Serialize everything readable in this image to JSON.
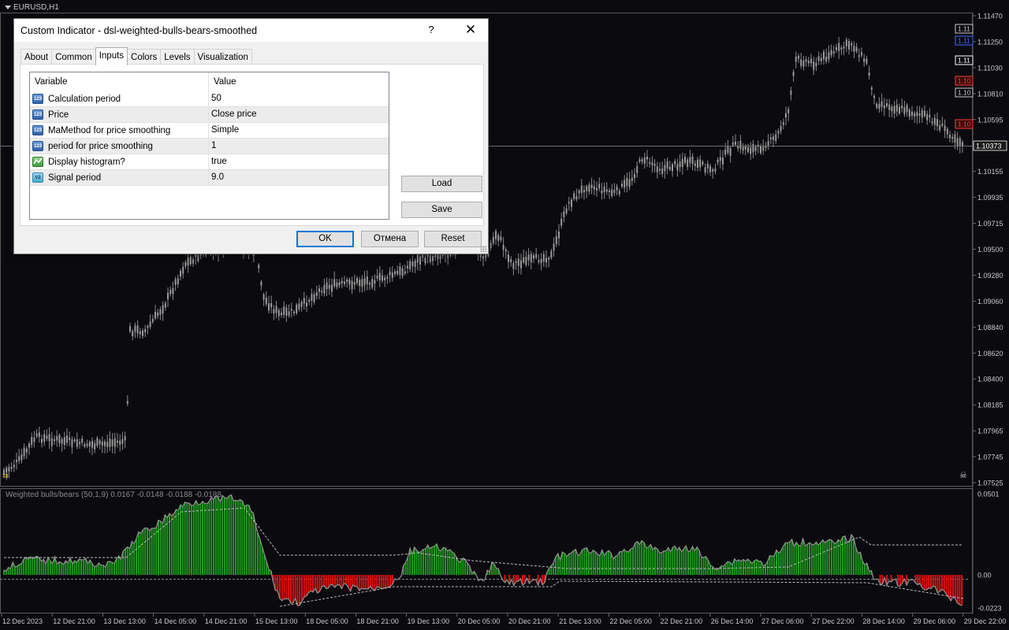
{
  "chart": {
    "symbol_label": "EURUSD,H1",
    "indicator_label": "Weighted bulls/bears (50,1,9) 0.0167 -0.0148 -0.0188 -0.0188",
    "current_price": "1.10373",
    "price_axis": [
      "1.11470",
      "1.11250",
      "1.11030",
      "1.10810",
      "1.10595",
      "1.10373",
      "1.10155",
      "1.09935",
      "1.09715",
      "1.09500",
      "1.09280",
      "1.09060",
      "1.08840",
      "1.08620",
      "1.08400",
      "1.08185",
      "1.07965",
      "1.07745",
      "1.07525"
    ],
    "indicator_axis": [
      "0.0501",
      "0.00",
      "-0.0223"
    ],
    "time_axis": [
      "12 Dec 2023",
      "12 Dec 21:00",
      "13 Dec 13:00",
      "14 Dec 05:00",
      "14 Dec 21:00",
      "15 Dec 13:00",
      "18 Dec 05:00",
      "18 Dec 21:00",
      "19 Dec 13:00",
      "20 Dec 05:00",
      "20 Dec 21:00",
      "21 Dec 13:00",
      "22 Dec 05:00",
      "22 Dec 21:00",
      "26 Dec 14:00",
      "27 Dec 06:00",
      "27 Dec 22:00",
      "28 Dec 14:00",
      "29 Dec 06:00",
      "29 Dec 22:00"
    ],
    "price_tags": [
      {
        "text": "1.11",
        "color": "#c8c8c8",
        "border": "#c8c8c8",
        "bg": "#0b0b0f"
      },
      {
        "text": "1.11",
        "color": "#3d6bff",
        "border": "#3d6bff",
        "bg": "#0b0b0f"
      },
      {
        "text": "1.11",
        "color": "#ffffff",
        "border": "#ffffff",
        "bg": "#0b0b0f"
      },
      {
        "text": "1.10",
        "color": "#ff3b3b",
        "border": "#ff3b3b",
        "bg": "#3a0b0b"
      },
      {
        "text": "1.10",
        "color": "#c8c8c8",
        "border": "#c8c8c8",
        "bg": "#0b0b0f"
      },
      {
        "text": "1.10",
        "color": "#ff3b3b",
        "border": "#ff3b3b",
        "bg": "#3a0b0b"
      }
    ],
    "colors": {
      "bull": "#1f9a1f",
      "bear": "#e01010",
      "candle": "#9a9a9a",
      "background": "#0b0b0f"
    }
  },
  "dialog": {
    "title": "Custom Indicator - dsl-weighted-bulls-bears-smoothed",
    "help_label": "?",
    "close_label": "✕",
    "tabs": [
      "About",
      "Common",
      "Inputs",
      "Colors",
      "Levels",
      "Visualization"
    ],
    "active_tab": "Inputs",
    "columns": {
      "variable": "Variable",
      "value": "Value"
    },
    "rows": [
      {
        "icon": "123",
        "icon_type": "num",
        "variable": "Calculation period",
        "value": "50"
      },
      {
        "icon": "123",
        "icon_type": "num",
        "variable": "Price",
        "value": "Close price"
      },
      {
        "icon": "123",
        "icon_type": "num",
        "variable": "MaMethod for price smoothing",
        "value": "Simple"
      },
      {
        "icon": "123",
        "icon_type": "num",
        "variable": "period for price smoothing",
        "value": "1"
      },
      {
        "icon": "",
        "icon_type": "bool",
        "variable": "Display histogram?",
        "value": "true"
      },
      {
        "icon": "V2",
        "icon_type": "dbl",
        "variable": "Signal period",
        "value": "9.0"
      }
    ],
    "load_label": "Load",
    "save_label": "Save",
    "ok_label": "OK",
    "cancel_label": "Отмена",
    "reset_label": "Reset"
  }
}
